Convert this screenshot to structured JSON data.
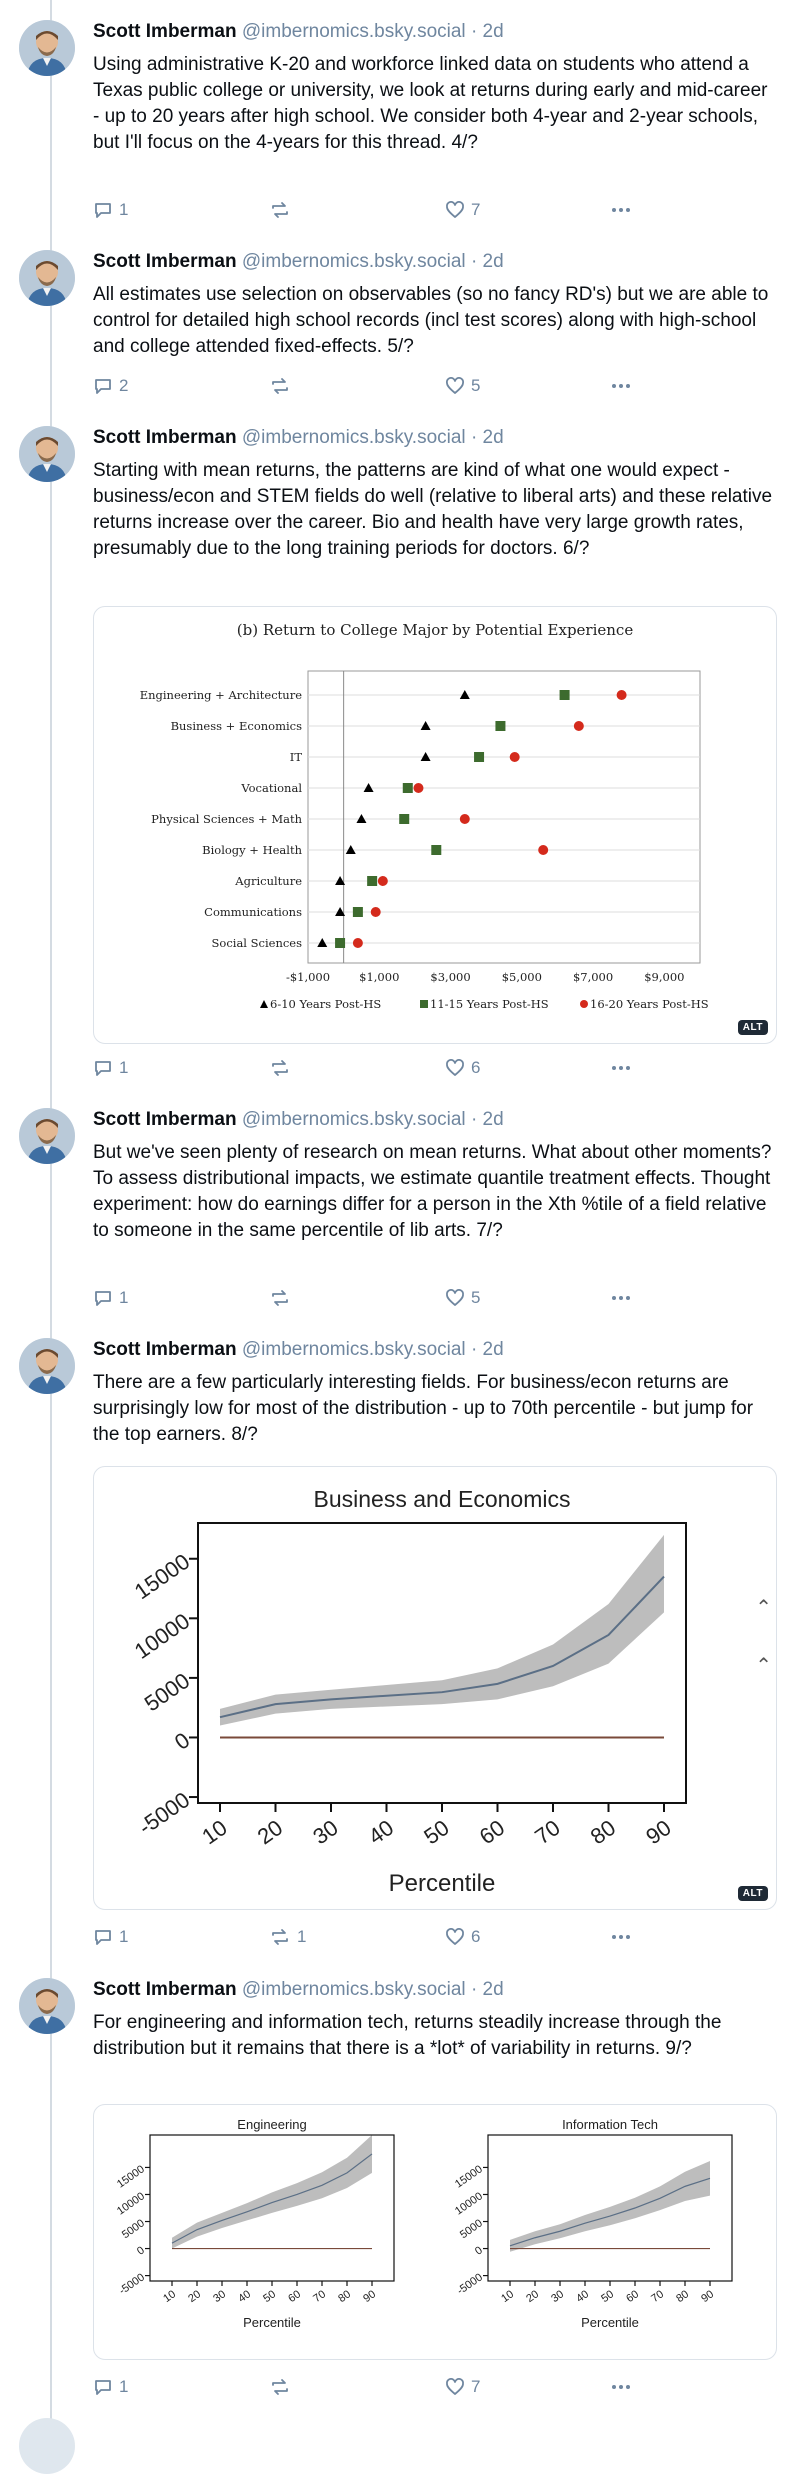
{
  "posts": [
    {
      "author": "Scott Imberman",
      "handle": "@imbernomics.bsky.social",
      "separator": "·",
      "time": "2d",
      "text": "Using administrative K-20 and workforce linked data on students who attend a Texas public college or university, we look at returns during early and mid-career - up to 20 years after high school. We consider both 4-year and 2-year schools, but I'll focus on the 4-years for this thread. 4/?",
      "replies": "1",
      "reposts": "",
      "likes": "7"
    },
    {
      "author": "Scott Imberman",
      "handle": "@imbernomics.bsky.social",
      "separator": "·",
      "time": "2d",
      "text": "All estimates use selection on observables (so no fancy RD's) but we are able to control for detailed high school records (incl test scores) along with high-school and college attended fixed-effects. 5/?",
      "replies": "2",
      "reposts": "",
      "likes": "5"
    },
    {
      "author": "Scott Imberman",
      "handle": "@imbernomics.bsky.social",
      "separator": "·",
      "time": "2d",
      "text": "Starting with mean returns, the patterns are kind of what one would expect - business/econ and STEM fields do well (relative to liberal arts) and these relative returns increase over the career. Bio and health have very large growth rates, presumably due to the long training periods for doctors. 6/?",
      "replies": "1",
      "reposts": "",
      "likes": "6",
      "alt": "ALT"
    },
    {
      "author": "Scott Imberman",
      "handle": "@imbernomics.bsky.social",
      "separator": "·",
      "time": "2d",
      "text": "But we've seen plenty of research on mean returns. What about other moments? To assess distributional impacts, we estimate quantile treatment effects. Thought experiment: how do earnings differ for a person in the Xth %tile of a field relative to someone in the same percentile of lib arts. 7/?",
      "replies": "1",
      "reposts": "",
      "likes": "5"
    },
    {
      "author": "Scott Imberman",
      "handle": "@imbernomics.bsky.social",
      "separator": "·",
      "time": "2d",
      "text": "There are a few particularly interesting fields. For business/econ returns are surprisingly low for most of the distribution - up to 70th percentile - but jump for the top earners. 8/?",
      "replies": "1",
      "reposts": "1",
      "likes": "6",
      "alt": "ALT"
    },
    {
      "author": "Scott Imberman",
      "handle": "@imbernomics.bsky.social",
      "separator": "·",
      "time": "2d",
      "text": "For engineering and information tech, returns steadily increase through the distribution but it remains that there is a *lot* of variability in returns. 9/?",
      "replies": "1",
      "reposts": "",
      "likes": "7"
    }
  ],
  "chart_data": [
    {
      "type": "scatter",
      "title": "(b) Return to College Major by Potential Experience",
      "categories": [
        "Engineering + Architecture",
        "Business + Economics",
        "IT",
        "Vocational",
        "Physical Sciences + Math",
        "Biology + Health",
        "Agriculture",
        "Communications",
        "Social Sciences"
      ],
      "series": [
        {
          "name": "6-10 Years Post-HS",
          "marker": "triangle",
          "color": "#000000",
          "values": [
            3400,
            2300,
            2300,
            700,
            500,
            200,
            -100,
            -100,
            -600
          ]
        },
        {
          "name": "11-15 Years Post-HS",
          "marker": "square",
          "color": "#3d6b2e",
          "values": [
            6200,
            4400,
            3800,
            1800,
            1700,
            2600,
            800,
            400,
            -100
          ]
        },
        {
          "name": "16-20 Years Post-HS",
          "marker": "circle",
          "color": "#d42a1c",
          "values": [
            7800,
            6600,
            4800,
            2100,
            3400,
            5600,
            1100,
            900,
            400
          ]
        }
      ],
      "xticks": [
        "-$1,000",
        "$1,000",
        "$3,000",
        "$5,000",
        "$7,000",
        "$9,000"
      ],
      "xlim": [
        -1000,
        10000
      ],
      "reference_line": 0,
      "grid": true,
      "legend": "bottom"
    },
    {
      "type": "line",
      "title": "Business and Economics",
      "xlabel": "Percentile",
      "x": [
        10,
        20,
        30,
        40,
        50,
        60,
        70,
        80,
        90
      ],
      "estimate": [
        1700,
        2800,
        3200,
        3500,
        3800,
        4500,
        6000,
        8600,
        13500
      ],
      "ci_low": [
        1000,
        2000,
        2400,
        2600,
        2800,
        3200,
        4300,
        6200,
        10500
      ],
      "ci_high": [
        2400,
        3600,
        4000,
        4400,
        4800,
        5800,
        7800,
        11200,
        17000
      ],
      "yticks": [
        "-5000",
        "0",
        "5000",
        "10000",
        "15000"
      ],
      "xticks": [
        "10",
        "20",
        "30",
        "40",
        "50",
        "60",
        "70",
        "80",
        "90"
      ],
      "ylim": [
        -5500,
        18000
      ]
    },
    {
      "type": "line",
      "title": "Engineering",
      "xlabel": "Percentile",
      "x": [
        10,
        20,
        30,
        40,
        50,
        60,
        70,
        80,
        90
      ],
      "estimate": [
        1000,
        3500,
        5200,
        6800,
        8500,
        10000,
        11700,
        14000,
        17500
      ],
      "ci_low": [
        0,
        2200,
        3800,
        5200,
        6600,
        7900,
        9300,
        11200,
        14000
      ],
      "ci_high": [
        2000,
        4800,
        6600,
        8400,
        10400,
        12100,
        14100,
        16800,
        21000
      ],
      "yticks": [
        "-5000",
        "0",
        "5000",
        "10000",
        "15000"
      ],
      "xticks": [
        "10",
        "20",
        "30",
        "40",
        "50",
        "60",
        "70",
        "80",
        "90"
      ],
      "ylim": [
        -6000,
        21000
      ]
    },
    {
      "type": "line",
      "title": "Information Tech",
      "xlabel": "Percentile",
      "x": [
        10,
        20,
        30,
        40,
        50,
        60,
        70,
        80,
        90
      ],
      "estimate": [
        500,
        2000,
        3200,
        4700,
        6000,
        7500,
        9300,
        11500,
        13000
      ],
      "ci_low": [
        -600,
        800,
        1900,
        3200,
        4300,
        5600,
        7100,
        8800,
        9800
      ],
      "ci_high": [
        1600,
        3200,
        4500,
        6200,
        7700,
        9400,
        11500,
        14200,
        16200
      ],
      "yticks": [
        "-5000",
        "0",
        "5000",
        "10000",
        "15000"
      ],
      "xticks": [
        "10",
        "20",
        "30",
        "40",
        "50",
        "60",
        "70",
        "80",
        "90"
      ],
      "ylim": [
        -6000,
        21000
      ]
    }
  ]
}
